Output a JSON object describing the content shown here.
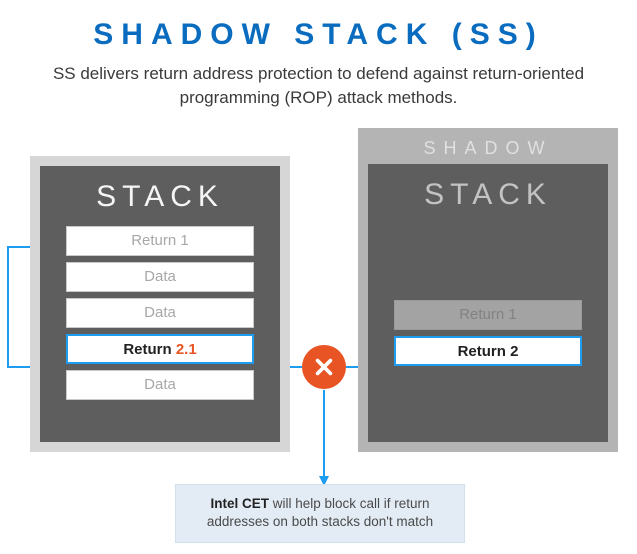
{
  "title": "SHADOW STACK (SS)",
  "subtitle": "SS delivers return address protection to defend against return-oriented programming (ROP) attack methods.",
  "left_stack": {
    "label": "STACK",
    "rows": {
      "r0": "Return 1",
      "r1": "Data",
      "r2": "Data",
      "r3_prefix": "Return ",
      "r3_red": "2.1",
      "r4": "Data"
    }
  },
  "right_stack": {
    "shadow_label": "SHADOW",
    "label": "STACK",
    "rows": {
      "r0": "Return 1",
      "r1_prefix": "Return ",
      "r1_bold": "2"
    }
  },
  "callout": {
    "bold": "Intel CET",
    "rest": " will help block call if return addresses on both stacks don't match"
  }
}
